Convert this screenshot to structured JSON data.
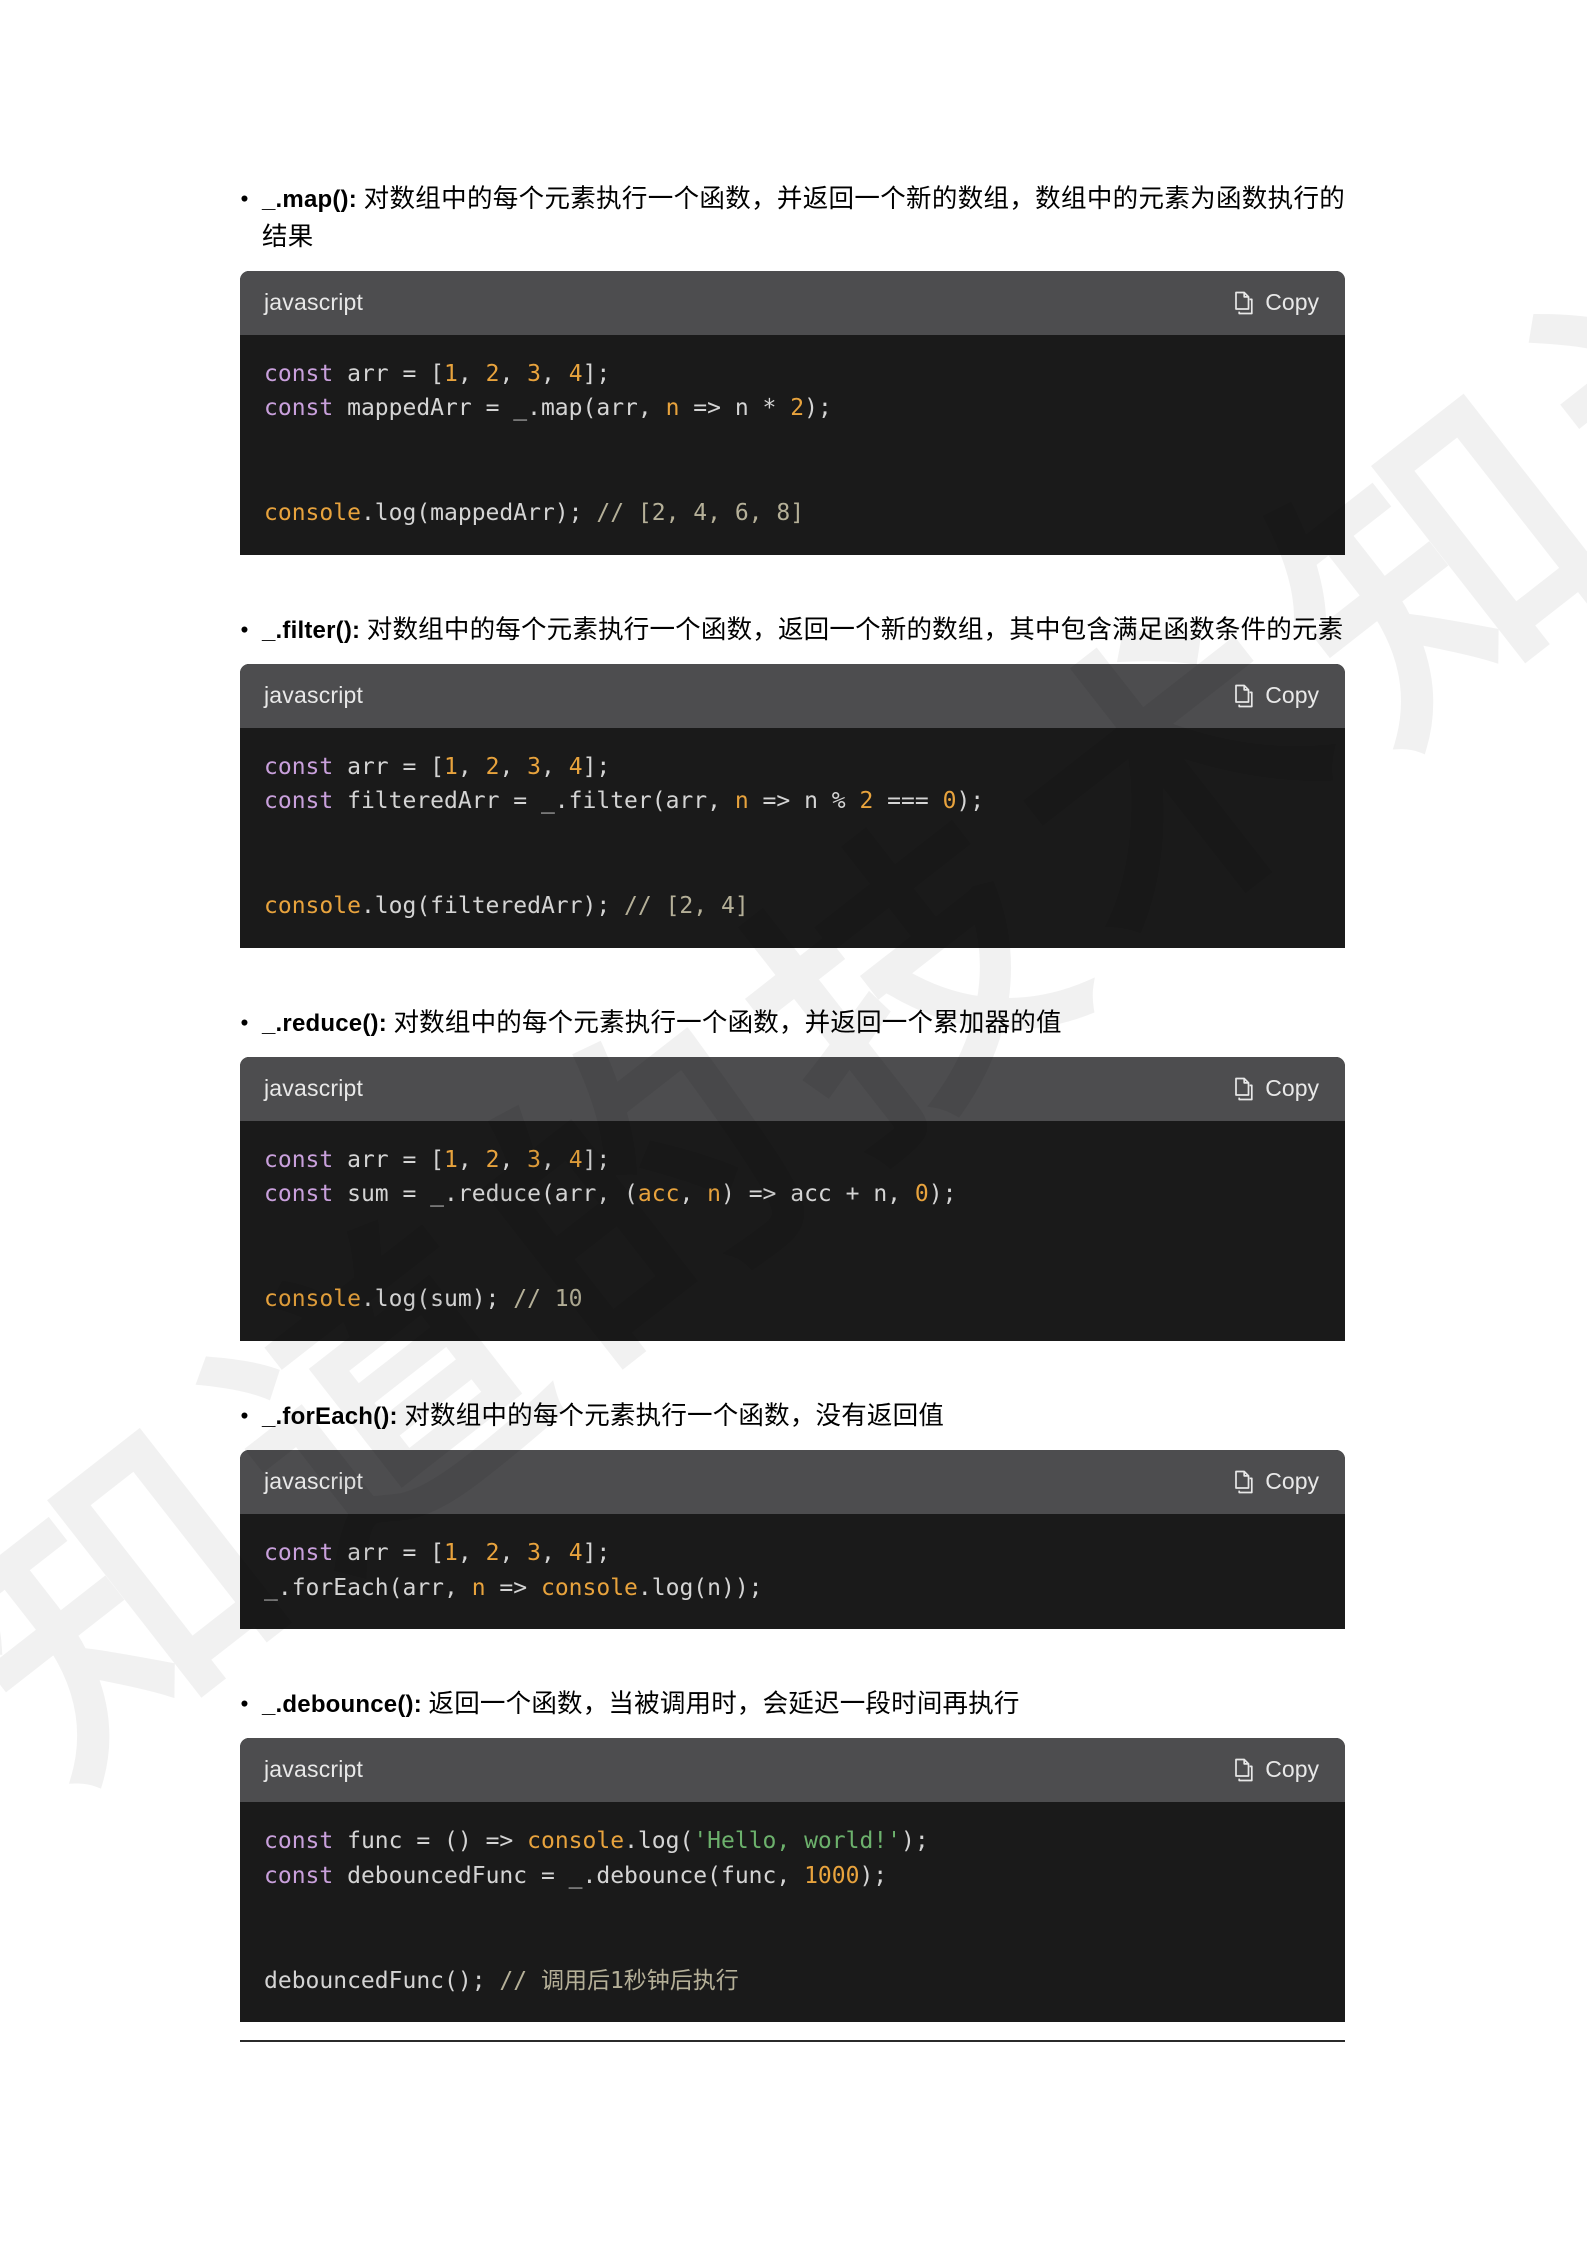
{
  "page": {
    "background": "#ffffff",
    "watermark_text": "不知道的技术知识"
  },
  "colors": {
    "code_header_bg": "#4d4d4f",
    "code_body_bg": "#1a1a1a",
    "keyword": "#c9a0dc",
    "number": "#e8a33d",
    "function": "#e8a33d",
    "string": "#6cb16c",
    "comment": "#b5b098",
    "plain": "#d4d4d4"
  },
  "common": {
    "bullet": "•",
    "lang_label": "javascript",
    "copy_label": "Copy",
    "copy_icon": "copy-icon"
  },
  "sections": [
    {
      "id": "map",
      "api": "_.map():",
      "description": "对数组中的每个元素执行一个函数，并返回一个新的数组，数组中的元素为函数执行的结果",
      "code_lines": [
        [
          {
            "t": "kw",
            "v": "const"
          },
          {
            "t": "pl",
            "v": " arr = ["
          },
          {
            "t": "num",
            "v": "1"
          },
          {
            "t": "pl",
            "v": ", "
          },
          {
            "t": "num",
            "v": "2"
          },
          {
            "t": "pl",
            "v": ", "
          },
          {
            "t": "num",
            "v": "3"
          },
          {
            "t": "pl",
            "v": ", "
          },
          {
            "t": "num",
            "v": "4"
          },
          {
            "t": "pl",
            "v": "];"
          }
        ],
        [
          {
            "t": "kw",
            "v": "const"
          },
          {
            "t": "pl",
            "v": " mappedArr = _.map(arr, "
          },
          {
            "t": "par",
            "v": "n"
          },
          {
            "t": "pl",
            "v": " => n * "
          },
          {
            "t": "num",
            "v": "2"
          },
          {
            "t": "pl",
            "v": ");"
          }
        ],
        [],
        [],
        [
          {
            "t": "fn",
            "v": "console"
          },
          {
            "t": "pl",
            "v": ".log(mappedArr); "
          },
          {
            "t": "cmt",
            "v": "// [2, 4, 6, 8]"
          }
        ]
      ]
    },
    {
      "id": "filter",
      "api": "_.filter():",
      "description": "对数组中的每个元素执行一个函数，返回一个新的数组，其中包含满足函数条件的元素",
      "code_lines": [
        [
          {
            "t": "kw",
            "v": "const"
          },
          {
            "t": "pl",
            "v": " arr = ["
          },
          {
            "t": "num",
            "v": "1"
          },
          {
            "t": "pl",
            "v": ", "
          },
          {
            "t": "num",
            "v": "2"
          },
          {
            "t": "pl",
            "v": ", "
          },
          {
            "t": "num",
            "v": "3"
          },
          {
            "t": "pl",
            "v": ", "
          },
          {
            "t": "num",
            "v": "4"
          },
          {
            "t": "pl",
            "v": "];"
          }
        ],
        [
          {
            "t": "kw",
            "v": "const"
          },
          {
            "t": "pl",
            "v": " filteredArr = _.filter(arr, "
          },
          {
            "t": "par",
            "v": "n"
          },
          {
            "t": "pl",
            "v": " => n % "
          },
          {
            "t": "num",
            "v": "2"
          },
          {
            "t": "pl",
            "v": " === "
          },
          {
            "t": "num",
            "v": "0"
          },
          {
            "t": "pl",
            "v": ");"
          }
        ],
        [],
        [],
        [
          {
            "t": "fn",
            "v": "console"
          },
          {
            "t": "pl",
            "v": ".log(filteredArr); "
          },
          {
            "t": "cmt",
            "v": "// [2, 4]"
          }
        ]
      ]
    },
    {
      "id": "reduce",
      "api": "_.reduce():",
      "description": "对数组中的每个元素执行一个函数，并返回一个累加器的值",
      "code_lines": [
        [
          {
            "t": "kw",
            "v": "const"
          },
          {
            "t": "pl",
            "v": " arr = ["
          },
          {
            "t": "num",
            "v": "1"
          },
          {
            "t": "pl",
            "v": ", "
          },
          {
            "t": "num",
            "v": "2"
          },
          {
            "t": "pl",
            "v": ", "
          },
          {
            "t": "num",
            "v": "3"
          },
          {
            "t": "pl",
            "v": ", "
          },
          {
            "t": "num",
            "v": "4"
          },
          {
            "t": "pl",
            "v": "];"
          }
        ],
        [
          {
            "t": "kw",
            "v": "const"
          },
          {
            "t": "pl",
            "v": " sum = _.reduce(arr, ("
          },
          {
            "t": "par",
            "v": "acc"
          },
          {
            "t": "pl",
            "v": ", "
          },
          {
            "t": "par",
            "v": "n"
          },
          {
            "t": "pl",
            "v": ") => acc + n, "
          },
          {
            "t": "num",
            "v": "0"
          },
          {
            "t": "pl",
            "v": ");"
          }
        ],
        [],
        [],
        [
          {
            "t": "fn",
            "v": "console"
          },
          {
            "t": "pl",
            "v": ".log(sum); "
          },
          {
            "t": "cmt",
            "v": "// 10"
          }
        ]
      ]
    },
    {
      "id": "foreach",
      "api": "_.forEach():",
      "description": "对数组中的每个元素执行一个函数，没有返回值",
      "code_lines": [
        [
          {
            "t": "kw",
            "v": "const"
          },
          {
            "t": "pl",
            "v": " arr = ["
          },
          {
            "t": "num",
            "v": "1"
          },
          {
            "t": "pl",
            "v": ", "
          },
          {
            "t": "num",
            "v": "2"
          },
          {
            "t": "pl",
            "v": ", "
          },
          {
            "t": "num",
            "v": "3"
          },
          {
            "t": "pl",
            "v": ", "
          },
          {
            "t": "num",
            "v": "4"
          },
          {
            "t": "pl",
            "v": "];"
          }
        ],
        [
          {
            "t": "pl",
            "v": "_.forEach(arr, "
          },
          {
            "t": "par",
            "v": "n"
          },
          {
            "t": "pl",
            "v": " => "
          },
          {
            "t": "fn",
            "v": "console"
          },
          {
            "t": "pl",
            "v": ".log(n));"
          }
        ]
      ]
    },
    {
      "id": "debounce",
      "api": "_.debounce():",
      "description": "返回一个函数，当被调用时，会延迟一段时间再执行",
      "code_lines": [
        [
          {
            "t": "kw",
            "v": "const"
          },
          {
            "t": "pl",
            "v": " func = () => "
          },
          {
            "t": "fn",
            "v": "console"
          },
          {
            "t": "pl",
            "v": ".log("
          },
          {
            "t": "str",
            "v": "'Hello, world!'"
          },
          {
            "t": "pl",
            "v": ");"
          }
        ],
        [
          {
            "t": "kw",
            "v": "const"
          },
          {
            "t": "pl",
            "v": " debouncedFunc = _.debounce(func, "
          },
          {
            "t": "num",
            "v": "1000"
          },
          {
            "t": "pl",
            "v": ");"
          }
        ],
        [],
        [],
        [
          {
            "t": "pl",
            "v": "debouncedFunc(); "
          },
          {
            "t": "cmt",
            "v": "// 调用后1秒钟后执行"
          }
        ]
      ]
    }
  ]
}
